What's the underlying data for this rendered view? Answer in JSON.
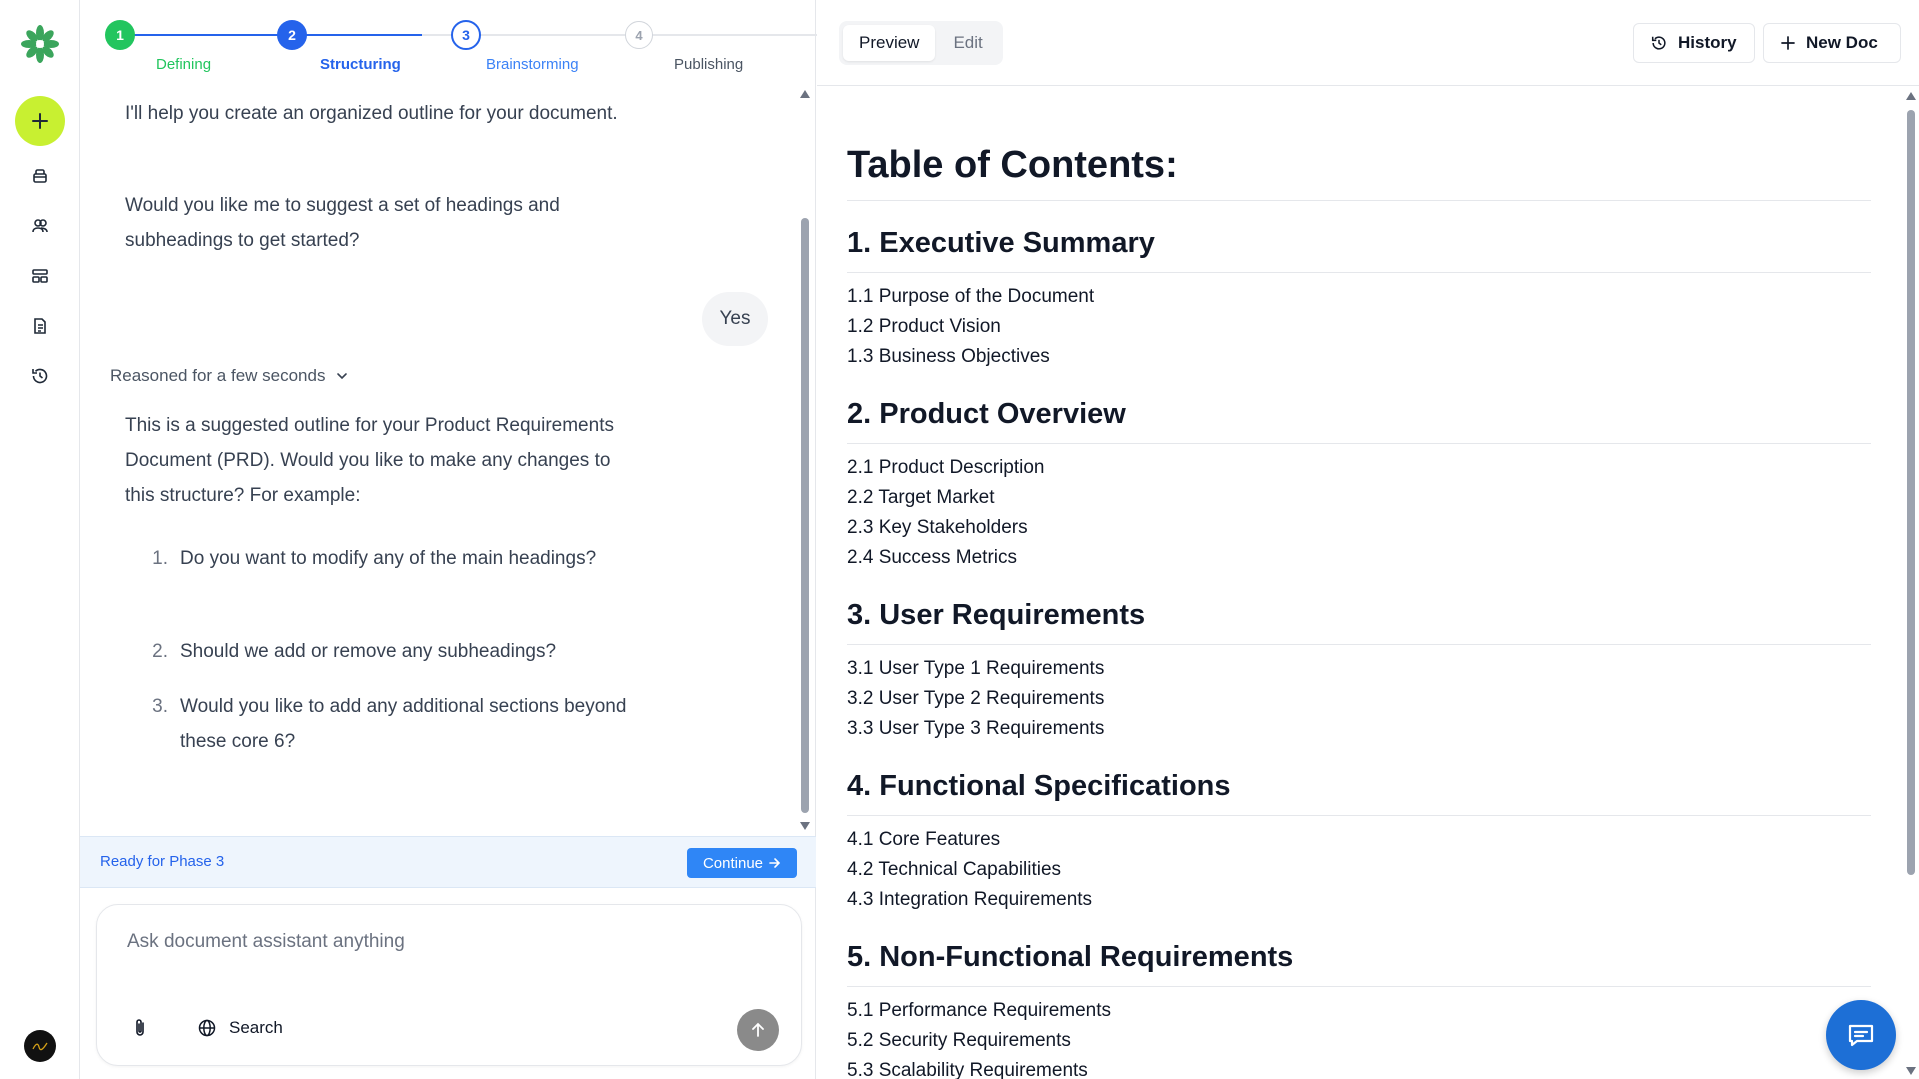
{
  "stepper": {
    "steps": [
      {
        "number": "1",
        "label": "Defining"
      },
      {
        "number": "2",
        "label": "Structuring"
      },
      {
        "number": "3",
        "label": "Brainstorming"
      },
      {
        "number": "4",
        "label": "Publishing"
      }
    ]
  },
  "chat": {
    "assistant_intro": "I'll help you create an organized outline for your document.",
    "assistant_question": "Would you like me to suggest a set of headings and subheadings to get started?",
    "user_reply": "Yes",
    "reasoned_label": "Reasoned for a few seconds",
    "assistant_outline_text": "This is a suggested outline for your Product Requirements Document (PRD). Would you like to make any changes to this structure? For example:",
    "list": [
      {
        "num": "1.",
        "text": "Do you want to modify any of the main headings?"
      },
      {
        "num": "2.",
        "text": "Should we add or remove any subheadings?"
      },
      {
        "num": "3.",
        "text": "Would you like to add any additional sections beyond these core 6?"
      }
    ],
    "phase_text": "Ready for Phase 3",
    "continue_label": "Continue",
    "input_placeholder": "Ask document assistant anything",
    "search_label": "Search"
  },
  "doc": {
    "tabs": {
      "preview": "Preview",
      "edit": "Edit"
    },
    "history_label": "History",
    "new_doc_label": "New Doc",
    "title": "Table of Contents:",
    "sections": [
      {
        "heading": "1. Executive Summary",
        "items": [
          "1.1 Purpose of the Document",
          "1.2 Product Vision",
          "1.3 Business Objectives"
        ]
      },
      {
        "heading": "2. Product Overview",
        "items": [
          "2.1 Product Description",
          "2.2 Target Market",
          "2.3 Key Stakeholders",
          "2.4 Success Metrics"
        ]
      },
      {
        "heading": "3. User Requirements",
        "items": [
          "3.1 User Type 1 Requirements",
          "3.2 User Type 2 Requirements",
          "3.3 User Type 3 Requirements"
        ]
      },
      {
        "heading": "4. Functional Specifications",
        "items": [
          "4.1 Core Features",
          "4.2 Technical Capabilities",
          "4.3 Integration Requirements"
        ]
      },
      {
        "heading": "5. Non-Functional Requirements",
        "items": [
          "5.1 Performance Requirements",
          "5.2 Security Requirements",
          "5.3 Scalability Requirements"
        ]
      }
    ]
  },
  "colors": {
    "accent_green": "#22c55e",
    "accent_blue": "#2563eb",
    "new_button": "#c8f031",
    "fab": "#1d6fd6"
  }
}
